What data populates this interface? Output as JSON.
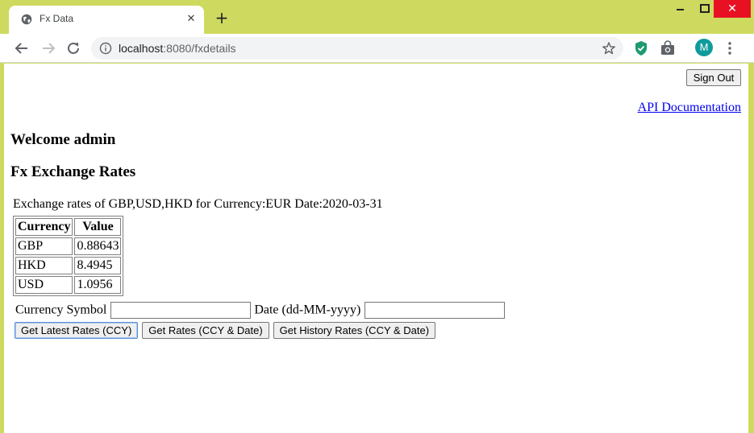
{
  "browser": {
    "tab_title": "Fx Data",
    "url_host": "localhost",
    "url_path": ":8080/fxdetails",
    "avatar_letter": "M",
    "accent_color": "#cdda5f"
  },
  "page": {
    "sign_out_label": "Sign Out",
    "api_link_label": "API Documentation",
    "welcome_text": "Welcome admin",
    "section_title": "Fx Exchange Rates",
    "rates_caption": "Exchange rates of GBP,USD,HKD for Currency:EUR Date:2020-03-31",
    "table": {
      "headers": [
        "Currency",
        "Value"
      ],
      "rows": [
        [
          "GBP",
          "0.88643"
        ],
        [
          "HKD",
          "8.4945"
        ],
        [
          "USD",
          "1.0956"
        ]
      ]
    },
    "form": {
      "currency_label": "Currency Symbol",
      "currency_value": "",
      "date_label": "Date (dd-MM-yyyy)",
      "date_value": ""
    },
    "buttons": {
      "latest": "Get Latest Rates (CCY)",
      "by_date": "Get Rates (CCY & Date)",
      "history": "Get History Rates (CCY & Date)"
    }
  }
}
